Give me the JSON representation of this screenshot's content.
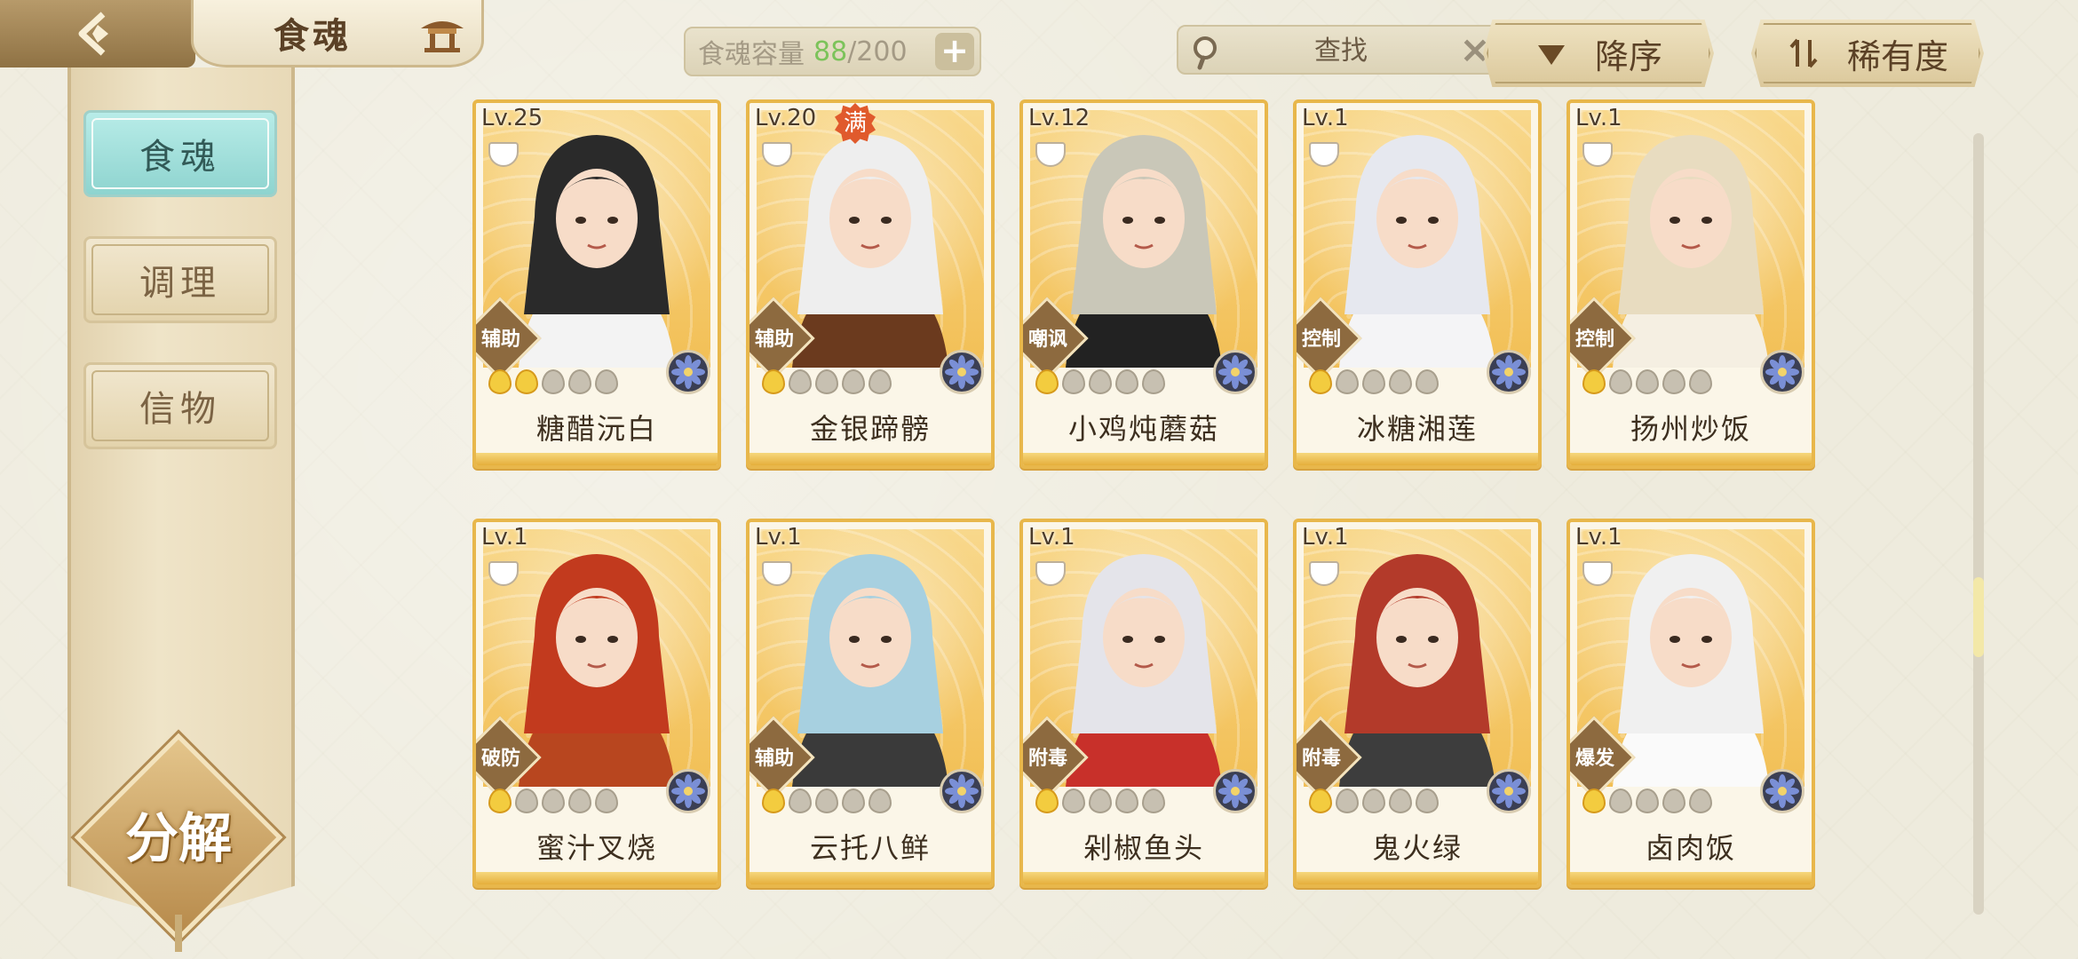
{
  "header": {
    "title": "食魂",
    "capacity_label": "食魂容量",
    "capacity_current": "88",
    "capacity_max": "/200",
    "search_placeholder": "查找",
    "sort_order_label": "降序",
    "sort_field_label": "稀有度"
  },
  "sidebar": {
    "items": [
      {
        "label": "食魂",
        "active": true
      },
      {
        "label": "调理",
        "active": false
      },
      {
        "label": "信物",
        "active": false
      }
    ],
    "decompose_label": "分解"
  },
  "colors": {
    "accent_teal": "#8ed4cf",
    "card_border_gold": "#e8b74b",
    "flame_lit": "#f3cc3f",
    "capacity_green": "#7cc35a"
  },
  "cards": [
    {
      "level": "Lv.25",
      "name": "糖醋沅白",
      "role": "辅助",
      "stars": 2,
      "full": false,
      "hair": "#2a2a2a",
      "outfit": "#f3f3f3"
    },
    {
      "level": "Lv.20",
      "name": "金银蹄髈",
      "role": "辅助",
      "stars": 1,
      "full": true,
      "full_label": "满",
      "hair": "#eeeeee",
      "outfit": "#6b3a1e"
    },
    {
      "level": "Lv.12",
      "name": "小鸡炖蘑菇",
      "role": "嘲讽",
      "stars": 1,
      "full": false,
      "hair": "#c9c7b8",
      "outfit": "#222222"
    },
    {
      "level": "Lv.1",
      "name": "冰糖湘莲",
      "role": "控制",
      "stars": 1,
      "full": false,
      "hair": "#e6e8ef",
      "outfit": "#f4f4f6"
    },
    {
      "level": "Lv.1",
      "name": "扬州炒饭",
      "role": "控制",
      "stars": 1,
      "full": false,
      "hair": "#e8dcc0",
      "outfit": "#f5efe2"
    },
    {
      "level": "Lv.1",
      "name": "蜜汁叉烧",
      "role": "破防",
      "stars": 1,
      "full": false,
      "hair": "#c23a1e",
      "outfit": "#b8461f"
    },
    {
      "level": "Lv.1",
      "name": "云托八鲜",
      "role": "辅助",
      "stars": 1,
      "full": false,
      "hair": "#a7d0e0",
      "outfit": "#3a3a3a"
    },
    {
      "level": "Lv.1",
      "name": "剁椒鱼头",
      "role": "附毒",
      "stars": 1,
      "full": false,
      "hair": "#e4e4ea",
      "outfit": "#c8302a"
    },
    {
      "level": "Lv.1",
      "name": "鬼火绿",
      "role": "附毒",
      "stars": 1,
      "full": false,
      "hair": "#b33a2a",
      "outfit": "#3d3d3d"
    },
    {
      "level": "Lv.1",
      "name": "卤肉饭",
      "role": "爆发",
      "stars": 1,
      "full": false,
      "hair": "#f0f0f0",
      "outfit": "#fafafa"
    }
  ]
}
